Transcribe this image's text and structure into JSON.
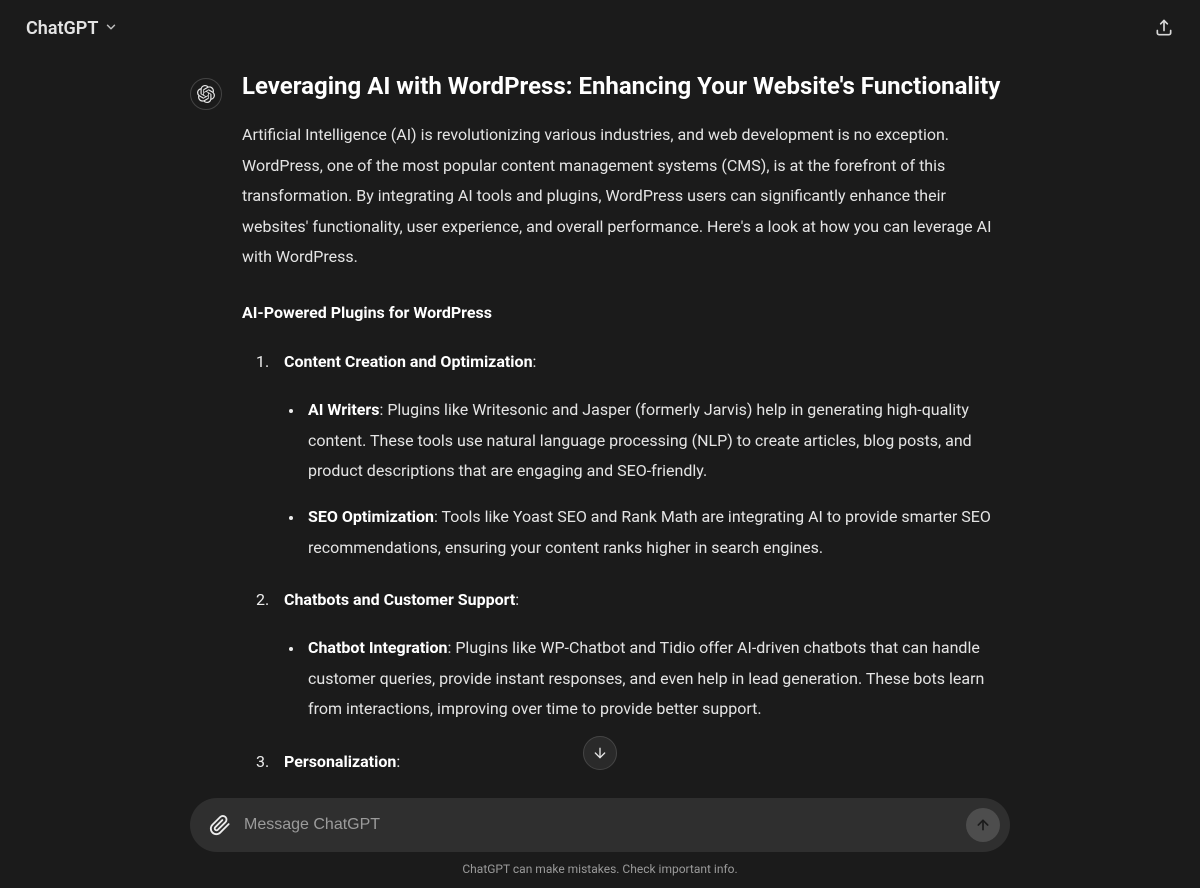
{
  "header": {
    "model_name": "ChatGPT"
  },
  "message": {
    "title": "Leveraging AI with WordPress: Enhancing Your Website's Functionality",
    "intro": "Artificial Intelligence (AI) is revolutionizing various industries, and web development is no exception. WordPress, one of the most popular content management systems (CMS), is at the forefront of this transformation. By integrating AI tools and plugins, WordPress users can significantly enhance their websites' functionality, user experience, and overall performance. Here's a look at how you can leverage AI with WordPress.",
    "section_heading": "AI-Powered Plugins for WordPress",
    "items": [
      {
        "num": "1.",
        "title": "Content Creation and Optimization",
        "sub": [
          {
            "label": "AI Writers",
            "text": ": Plugins like Writesonic and Jasper (formerly Jarvis) help in generating high-quality content. These tools use natural language processing (NLP) to create articles, blog posts, and product descriptions that are engaging and SEO-friendly."
          },
          {
            "label": "SEO Optimization",
            "text": ": Tools like Yoast SEO and Rank Math are integrating AI to provide smarter SEO recommendations, ensuring your content ranks higher in search engines."
          }
        ]
      },
      {
        "num": "2.",
        "title": "Chatbots and Customer Support",
        "sub": [
          {
            "label": "Chatbot Integration",
            "text": ": Plugins like WP-Chatbot and Tidio offer AI-driven chatbots that can handle customer queries, provide instant responses, and even help in lead generation. These bots learn from interactions, improving over time to provide better support."
          }
        ]
      },
      {
        "num": "3.",
        "title": "Personalization",
        "sub": []
      }
    ]
  },
  "composer": {
    "placeholder": "Message ChatGPT"
  },
  "footer": {
    "disclaimer": "ChatGPT can make mistakes. Check important info."
  }
}
